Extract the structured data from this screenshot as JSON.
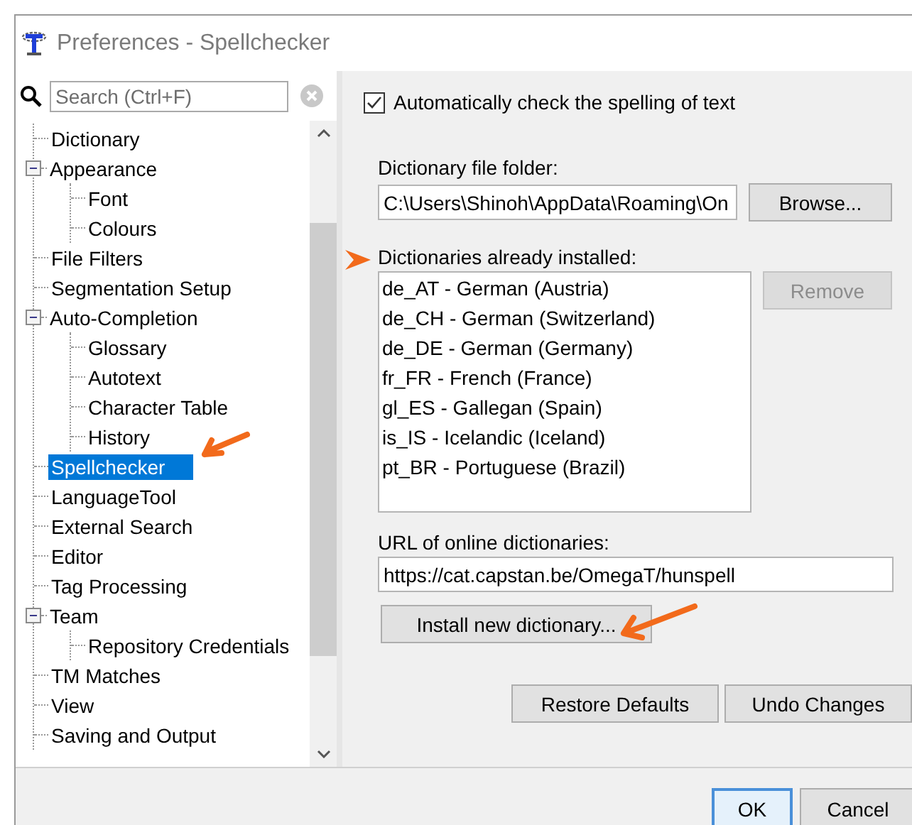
{
  "window": {
    "title": "Preferences - Spellchecker"
  },
  "search": {
    "placeholder": "Search (Ctrl+F)"
  },
  "tree": [
    {
      "label": "Dictionary",
      "selected": false
    },
    {
      "label": "Appearance",
      "selected": false,
      "expanded": true,
      "children": [
        {
          "label": "Font",
          "selected": false
        },
        {
          "label": "Colours",
          "selected": false
        }
      ]
    },
    {
      "label": "File Filters",
      "selected": false
    },
    {
      "label": "Segmentation Setup",
      "selected": false
    },
    {
      "label": "Auto-Completion",
      "selected": false,
      "expanded": true,
      "children": [
        {
          "label": "Glossary",
          "selected": false
        },
        {
          "label": "Autotext",
          "selected": false
        },
        {
          "label": "Character Table",
          "selected": false
        },
        {
          "label": "History",
          "selected": false
        }
      ]
    },
    {
      "label": "Spellchecker",
      "selected": true
    },
    {
      "label": "LanguageTool",
      "selected": false
    },
    {
      "label": "External Search",
      "selected": false
    },
    {
      "label": "Editor",
      "selected": false
    },
    {
      "label": "Tag Processing",
      "selected": false
    },
    {
      "label": "Team",
      "selected": false,
      "expanded": true,
      "children": [
        {
          "label": "Repository Credentials",
          "selected": false
        }
      ]
    },
    {
      "label": "TM Matches",
      "selected": false
    },
    {
      "label": "View",
      "selected": false
    },
    {
      "label": "Saving and Output",
      "selected": false
    }
  ],
  "auto_check": {
    "label": "Automatically check the spelling of text",
    "checked": true
  },
  "folder": {
    "label": "Dictionary file folder:",
    "value": "C:\\Users\\Shinoh\\AppData\\Roaming\\On",
    "button": {
      "label": "Browse...",
      "disabled": false
    }
  },
  "installed": {
    "label": "Dictionaries already installed:",
    "items": [
      {
        "label": "de_AT - German (Austria)",
        "selected": false
      },
      {
        "label": "de_CH - German (Switzerland)",
        "selected": false
      },
      {
        "label": "de_DE - German (Germany)",
        "selected": false
      },
      {
        "label": "fr_FR - French (France)",
        "selected": false
      },
      {
        "label": "gl_ES - Gallegan (Spain)",
        "selected": false
      },
      {
        "label": "is_IS - Icelandic (Iceland)",
        "selected": false
      },
      {
        "label": "pt_BR - Portuguese (Brazil)",
        "selected": false
      }
    ],
    "button": {
      "label": "Remove",
      "disabled": true
    }
  },
  "online": {
    "label": "URL of online dictionaries:",
    "value": "https://cat.capstan.be/OmegaT/hunspell",
    "button": {
      "label": "Install new dictionary...",
      "disabled": false
    }
  },
  "panel_buttons": [
    {
      "label": "Restore Defaults",
      "default": false
    },
    {
      "label": "Undo Changes",
      "default": false
    }
  ],
  "dialog_buttons": [
    {
      "label": "OK",
      "default": true
    },
    {
      "label": "Cancel",
      "default": false
    }
  ]
}
